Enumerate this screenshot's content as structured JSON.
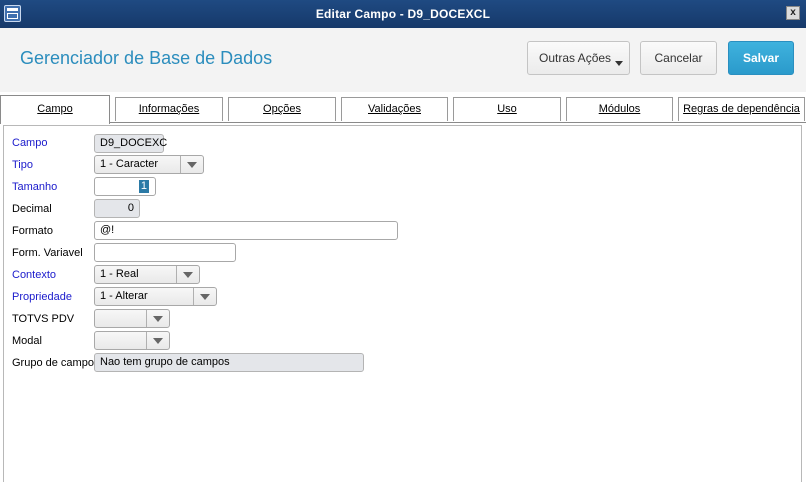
{
  "window": {
    "title": "Editar Campo - D9_DOCEXCL",
    "close_glyph": "x"
  },
  "header": {
    "title": "Gerenciador de Base de Dados",
    "buttons": {
      "more_actions": "Outras Ações",
      "cancel": "Cancelar",
      "save": "Salvar"
    }
  },
  "tabs": [
    {
      "label": "Campo",
      "active": true
    },
    {
      "label": "Informações"
    },
    {
      "label": "Opções"
    },
    {
      "label": "Validações"
    },
    {
      "label": "Uso"
    },
    {
      "label": "Módulos"
    },
    {
      "label": "Regras de dependência"
    }
  ],
  "form": {
    "campo": {
      "label": "Campo",
      "value": "D9_DOCEXC"
    },
    "tipo": {
      "label": "Tipo",
      "value": "1 - Caracter"
    },
    "tamanho": {
      "label": "Tamanho",
      "value": "1"
    },
    "decimal": {
      "label": "Decimal",
      "value": "0"
    },
    "formato": {
      "label": "Formato",
      "value": "@!"
    },
    "form_variavel": {
      "label": "Form. Variavel",
      "value": ""
    },
    "contexto": {
      "label": "Contexto",
      "value": "1 - Real"
    },
    "propriedade": {
      "label": "Propriedade",
      "value": "1 - Alterar"
    },
    "totvs_pdv": {
      "label": "TOTVS PDV",
      "value": ""
    },
    "modal": {
      "label": "Modal",
      "value": ""
    },
    "grupo_campos": {
      "label": "Grupo de campos",
      "value": "Nao tem grupo de campos"
    }
  },
  "colors": {
    "titlebar": "#1f4a82",
    "accent": "#2b8dbd",
    "save": "#2a9acb",
    "required_label": "#1a1acc"
  }
}
